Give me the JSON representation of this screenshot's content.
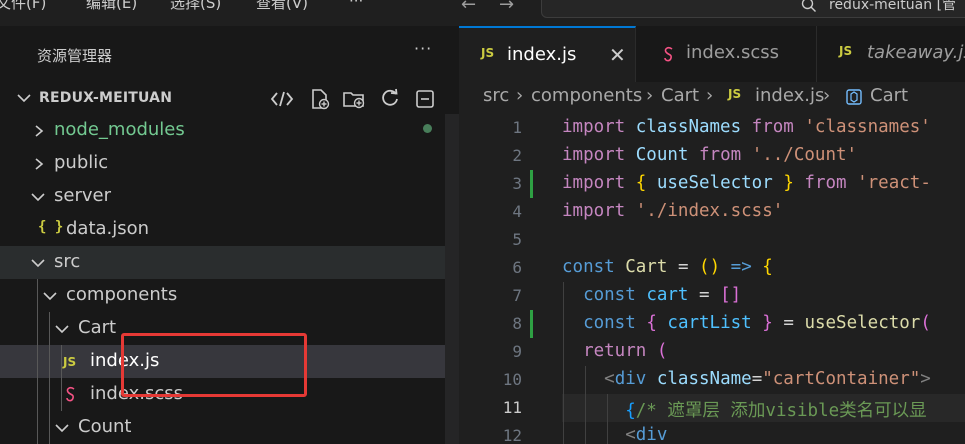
{
  "menu": [
    "文件(F)",
    "编辑(E)",
    "选择(S)",
    "查看(V)",
    "···"
  ],
  "search": {
    "text": "redux-meituan [管"
  },
  "explorer": {
    "title": "资源管理器",
    "more": "···",
    "section_title": "REDUX-MEITUAN",
    "tree": [
      {
        "label": "node_modules"
      },
      {
        "label": "public"
      },
      {
        "label": "server"
      },
      {
        "label": "data.json",
        "icon": "{ }"
      },
      {
        "label": "src"
      },
      {
        "label": "components"
      },
      {
        "label": "Cart"
      },
      {
        "label": "index.js",
        "icon": "JS"
      },
      {
        "label": "index.scss"
      },
      {
        "label": "Count"
      }
    ]
  },
  "tabs": [
    {
      "label": "index.js",
      "icon": "JS",
      "close": "✕"
    },
    {
      "label": "index.scss"
    },
    {
      "label": "takeaway.js",
      "icon": "JS"
    }
  ],
  "breadcrumb": {
    "items": [
      "src",
      "components",
      "Cart",
      "index.js",
      "Cart"
    ],
    "sep": "›",
    "js": "JS"
  },
  "code": {
    "line_numbers": [
      "1",
      "2",
      "3",
      "4",
      "5",
      "6",
      "7",
      "8",
      "9",
      "10",
      "11",
      "12"
    ],
    "tokens": {
      "import": "import",
      "from": "from",
      "const": "const",
      "return": "return",
      "classNames": "classNames",
      "Count": "Count",
      "useSelector": "useSelector",
      "s_classnames": "'classnames'",
      "s_count": "'../Count'",
      "s_react": "'react-",
      "s_scss": "'./index.scss'",
      "Cart": "Cart",
      "cart": "cart",
      "cartList": "cartList",
      "div": "div",
      "className": "className",
      "s_container": "\"cartContainer\"",
      "comment": "/* 遮罩层 添加visible类名可以显"
    }
  },
  "colors": {
    "accent": "#0078d4",
    "highlight_box": "#e53935",
    "git_added": "#2ea043"
  }
}
